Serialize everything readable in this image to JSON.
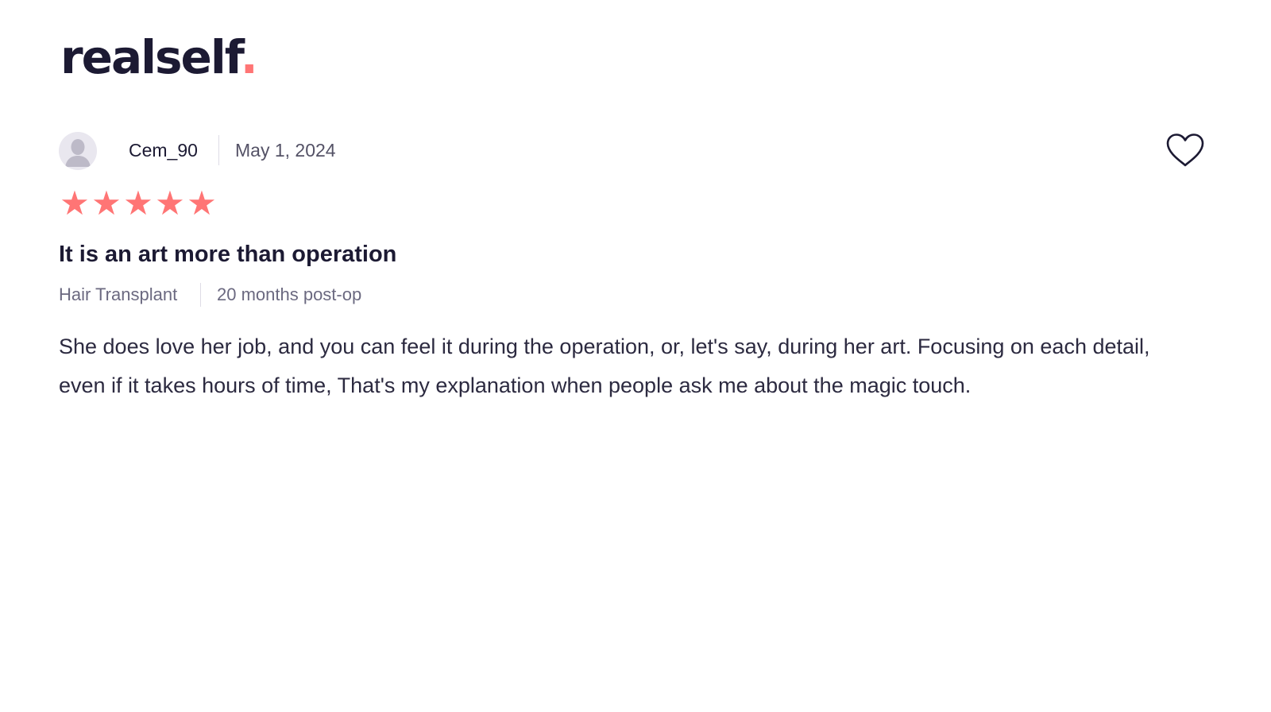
{
  "brand": {
    "name": "realself",
    "dot": ".",
    "accent_color": "#ff7575",
    "text_color": "#1c1a33"
  },
  "review": {
    "author": "Cem_90",
    "date": "May 1, 2024",
    "avatar_icon": "user-silhouette-icon",
    "favorite_icon": "heart-outline-icon",
    "rating": 5,
    "rating_max": 5,
    "title": "It is an art more than operation",
    "procedure": "Hair Transplant",
    "time_post_op": "20 months post-op",
    "body": "She does love her job, and you can feel it during the operation, or, let's say, during her art. Focusing on each detail, even if it takes hours of time, That's my explanation when people ask me about the magic touch."
  }
}
